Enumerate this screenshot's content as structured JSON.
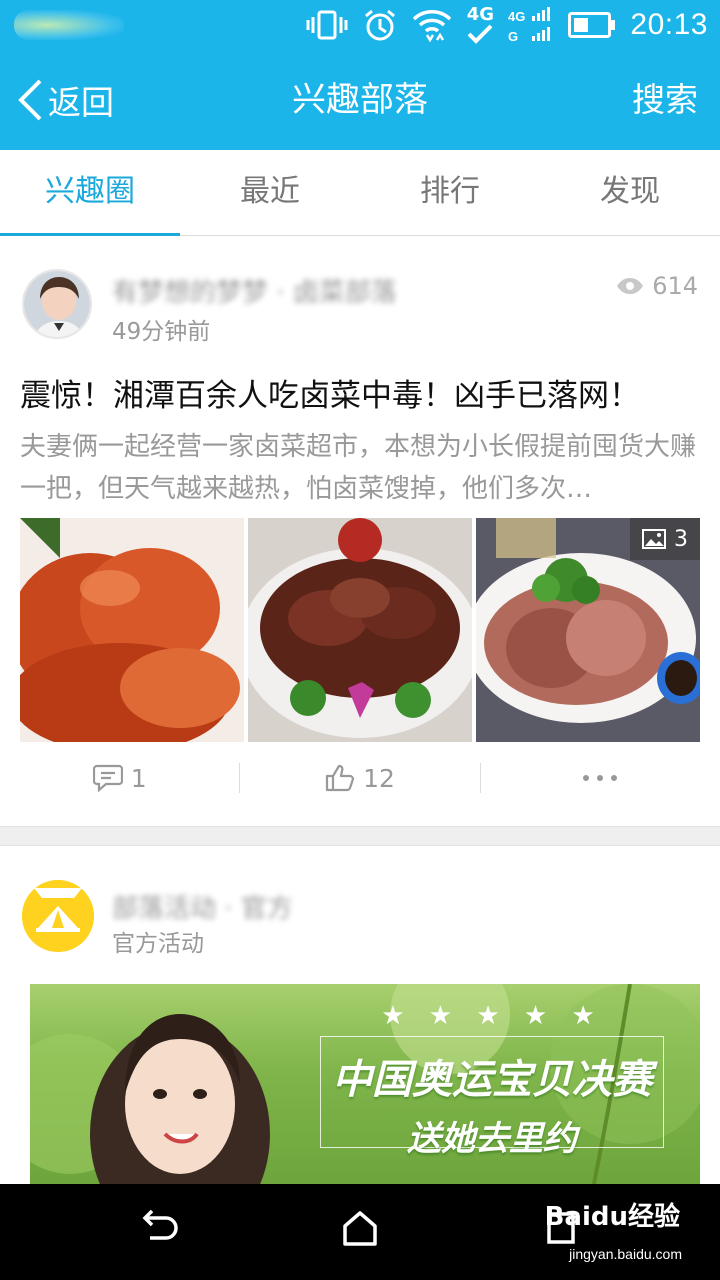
{
  "status_bar": {
    "time": "20:13",
    "network_label": "4G",
    "icons": [
      "vibrate-icon",
      "alarm-icon",
      "wifi-icon",
      "4g-icon",
      "signal-icon",
      "battery-icon"
    ]
  },
  "navbar": {
    "back_label": "返回",
    "title": "兴趣部落",
    "search_label": "搜索",
    "background": "#1bb5e9"
  },
  "tabs": [
    {
      "label": "兴趣圈",
      "active": true
    },
    {
      "label": "最近",
      "active": false
    },
    {
      "label": "排行",
      "active": false
    },
    {
      "label": "发现",
      "active": false
    }
  ],
  "post1": {
    "author_blurred": "有梦想的梦梦  · 卤菜部落",
    "time_ago": "49分钟前",
    "views": "614",
    "title": "震惊！湘潭百余人吃卤菜中毒！凶手已落网！",
    "summary": "夫妻俩一起经营一家卤菜超市，本想为小长假提前囤货大赚一把，但天气越来越热，怕卤菜馊掉，他们多次…",
    "image_count": "3",
    "comments": "1",
    "likes": "12"
  },
  "post2": {
    "author_blurred": "部落活动 · 官方",
    "tag": "官方活动",
    "banner_line1": "中国奥运宝贝决赛",
    "banner_line2": "送她去里约"
  },
  "watermark": {
    "brand": "Baidu经验",
    "url": "jingyan.baidu.com"
  },
  "colors": {
    "accent": "#1bb5e9",
    "tab_active": "#1ba9db",
    "muted_text": "#999999"
  }
}
